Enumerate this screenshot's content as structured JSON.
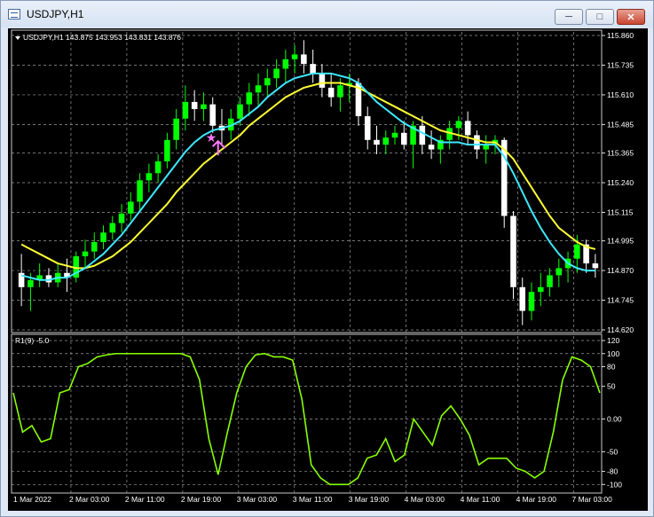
{
  "window": {
    "title": "USDJPY,H1",
    "minimize_icon": "minimize-icon",
    "maximize_icon": "maximize-icon",
    "close_icon": "close-icon"
  },
  "main_chart": {
    "info_line": "USDJPY,H1  143.875 143.953 143.831 143.876",
    "signal_icon": "star-icon"
  },
  "indicator": {
    "label": "R1(9) -5.0"
  },
  "colors": {
    "bull": "#00ff00",
    "bear": "#ffffff",
    "ma_fast": "#3ee8ff",
    "ma_slow": "#ffff33",
    "rsi_line": "#88ff00",
    "grid": "#9a9a9a",
    "star": "#ff77ff",
    "arrow": "#ff77ff"
  },
  "chart_data": [
    {
      "type": "candlestick",
      "title": "USDJPY,H1",
      "ylim": [
        114.62,
        115.86
      ],
      "y_ticks": [
        "115.860",
        "115.735",
        "115.610",
        "115.485",
        "115.365",
        "115.240",
        "115.115",
        "114.995",
        "114.870",
        "114.745",
        "114.620"
      ],
      "x_ticks": [
        "1 Mar 2022",
        "2 Mar 03:00",
        "2 Mar 11:00",
        "2 Mar 19:00",
        "3 Mar 03:00",
        "3 Mar 11:00",
        "3 Mar 19:00",
        "4 Mar 03:00",
        "4 Mar 11:00",
        "4 Mar 19:00",
        "7 Mar 03:00"
      ],
      "candles": [
        [
          114.86,
          114.94,
          114.72,
          114.8
        ],
        [
          114.8,
          114.86,
          114.7,
          114.83
        ],
        [
          114.83,
          114.9,
          114.8,
          114.85
        ],
        [
          114.85,
          114.88,
          114.8,
          114.82
        ],
        [
          114.82,
          114.9,
          114.8,
          114.86
        ],
        [
          114.86,
          114.92,
          114.78,
          114.84
        ],
        [
          114.84,
          114.95,
          114.82,
          114.93
        ],
        [
          114.93,
          115.0,
          114.88,
          114.95
        ],
        [
          114.95,
          115.03,
          114.92,
          114.99
        ],
        [
          114.99,
          115.06,
          114.96,
          115.03
        ],
        [
          115.03,
          115.1,
          115.0,
          115.07
        ],
        [
          115.07,
          115.15,
          115.03,
          115.11
        ],
        [
          115.11,
          115.2,
          115.08,
          115.16
        ],
        [
          115.16,
          115.28,
          115.12,
          115.25
        ],
        [
          115.25,
          115.32,
          115.2,
          115.28
        ],
        [
          115.28,
          115.36,
          115.24,
          115.33
        ],
        [
          115.33,
          115.45,
          115.3,
          115.42
        ],
        [
          115.42,
          115.55,
          115.38,
          115.51
        ],
        [
          115.51,
          115.65,
          115.46,
          115.58
        ],
        [
          115.58,
          115.63,
          115.5,
          115.55
        ],
        [
          115.55,
          115.62,
          115.5,
          115.57
        ],
        [
          115.57,
          115.6,
          115.45,
          115.48
        ],
        [
          115.48,
          115.55,
          115.4,
          115.46
        ],
        [
          115.46,
          115.55,
          115.42,
          115.51
        ],
        [
          115.51,
          115.6,
          115.48,
          115.57
        ],
        [
          115.57,
          115.66,
          115.52,
          115.62
        ],
        [
          115.62,
          115.7,
          115.56,
          115.65
        ],
        [
          115.65,
          115.72,
          115.6,
          115.68
        ],
        [
          115.68,
          115.76,
          115.64,
          115.72
        ],
        [
          115.72,
          115.8,
          115.66,
          115.76
        ],
        [
          115.76,
          115.82,
          115.7,
          115.78
        ],
        [
          115.78,
          115.84,
          115.7,
          115.74
        ],
        [
          115.74,
          115.8,
          115.66,
          115.7
        ],
        [
          115.7,
          115.74,
          115.6,
          115.64
        ],
        [
          115.64,
          115.7,
          115.56,
          115.6
        ],
        [
          115.6,
          115.68,
          115.54,
          115.65
        ],
        [
          115.65,
          115.7,
          115.58,
          115.66
        ],
        [
          115.66,
          115.68,
          115.48,
          115.52
        ],
        [
          115.52,
          115.56,
          115.38,
          115.42
        ],
        [
          115.42,
          115.48,
          115.36,
          115.4
        ],
        [
          115.4,
          115.46,
          115.36,
          115.43
        ],
        [
          115.43,
          115.48,
          115.4,
          115.45
        ],
        [
          115.45,
          115.5,
          115.38,
          115.4
        ],
        [
          115.4,
          115.5,
          115.3,
          115.48
        ],
        [
          115.48,
          115.52,
          115.36,
          115.4
        ],
        [
          115.4,
          115.46,
          115.34,
          115.38
        ],
        [
          115.38,
          115.44,
          115.32,
          115.42
        ],
        [
          115.42,
          115.5,
          115.38,
          115.47
        ],
        [
          115.47,
          115.52,
          115.42,
          115.5
        ],
        [
          115.5,
          115.54,
          115.4,
          115.44
        ],
        [
          115.44,
          115.46,
          115.34,
          115.38
        ],
        [
          115.38,
          115.44,
          115.32,
          115.4
        ],
        [
          115.4,
          115.44,
          115.36,
          115.42
        ],
        [
          115.42,
          115.43,
          115.05,
          115.1
        ],
        [
          115.1,
          115.12,
          114.75,
          114.8
        ],
        [
          114.8,
          114.84,
          114.64,
          114.7
        ],
        [
          114.7,
          114.82,
          114.66,
          114.78
        ],
        [
          114.78,
          114.86,
          114.72,
          114.8
        ],
        [
          114.8,
          114.88,
          114.76,
          114.85
        ],
        [
          114.85,
          114.92,
          114.8,
          114.88
        ],
        [
          114.88,
          114.95,
          114.82,
          114.92
        ],
        [
          114.92,
          115.02,
          114.86,
          114.98
        ],
        [
          114.98,
          115.0,
          114.86,
          114.9
        ],
        [
          114.9,
          114.94,
          114.84,
          114.88
        ]
      ],
      "series": [
        {
          "name": "ma_fast",
          "values": [
            114.85,
            114.84,
            114.83,
            114.83,
            114.84,
            114.84,
            114.86,
            114.88,
            114.91,
            114.94,
            114.98,
            115.02,
            115.07,
            115.12,
            115.17,
            115.22,
            115.27,
            115.32,
            115.37,
            115.41,
            115.44,
            115.46,
            115.47,
            115.48,
            115.5,
            115.53,
            115.56,
            115.6,
            115.63,
            115.66,
            115.68,
            115.69,
            115.7,
            115.7,
            115.7,
            115.69,
            115.68,
            115.66,
            115.62,
            115.58,
            115.55,
            115.52,
            115.49,
            115.47,
            115.45,
            115.43,
            115.41,
            115.41,
            115.41,
            115.4,
            115.4,
            115.4,
            115.4,
            115.35,
            115.28,
            115.2,
            115.12,
            115.05,
            114.99,
            114.94,
            114.9,
            114.88,
            114.87,
            114.87
          ]
        },
        {
          "name": "ma_slow",
          "values": [
            114.98,
            114.96,
            114.94,
            114.92,
            114.9,
            114.89,
            114.88,
            114.88,
            114.89,
            114.91,
            114.93,
            114.96,
            114.99,
            115.03,
            115.07,
            115.11,
            115.15,
            115.2,
            115.24,
            115.28,
            115.32,
            115.35,
            115.38,
            115.41,
            115.44,
            115.48,
            115.51,
            115.54,
            115.57,
            115.6,
            115.62,
            115.64,
            115.65,
            115.66,
            115.66,
            115.66,
            115.65,
            115.64,
            115.62,
            115.6,
            115.58,
            115.56,
            115.54,
            115.52,
            115.5,
            115.48,
            115.46,
            115.45,
            115.44,
            115.43,
            115.42,
            115.41,
            115.41,
            115.38,
            115.34,
            115.28,
            115.22,
            115.16,
            115.1,
            115.05,
            115.02,
            114.99,
            114.97,
            114.96
          ]
        }
      ]
    },
    {
      "type": "line",
      "title": "R1(9) -5.0",
      "ylim": [
        -105,
        120
      ],
      "y_ticks": [
        "120",
        "100",
        "80",
        "50",
        "0.00",
        "-50",
        "-80",
        "-100"
      ],
      "series": [
        {
          "name": "R1(9)",
          "values": [
            40,
            -20,
            -10,
            -35,
            -30,
            40,
            45,
            80,
            85,
            95,
            98,
            100,
            100,
            100,
            100,
            100,
            100,
            100,
            100,
            95,
            60,
            -30,
            -85,
            -20,
            40,
            80,
            98,
            100,
            95,
            95,
            90,
            30,
            -70,
            -90,
            -100,
            -100,
            -100,
            -90,
            -60,
            -55,
            -30,
            -65,
            -55,
            0,
            -20,
            -40,
            5,
            20,
            0,
            -25,
            -70,
            -60,
            -60,
            -60,
            -75,
            -80,
            -90,
            -80,
            -20,
            60,
            95,
            90,
            80,
            40
          ]
        }
      ]
    }
  ]
}
